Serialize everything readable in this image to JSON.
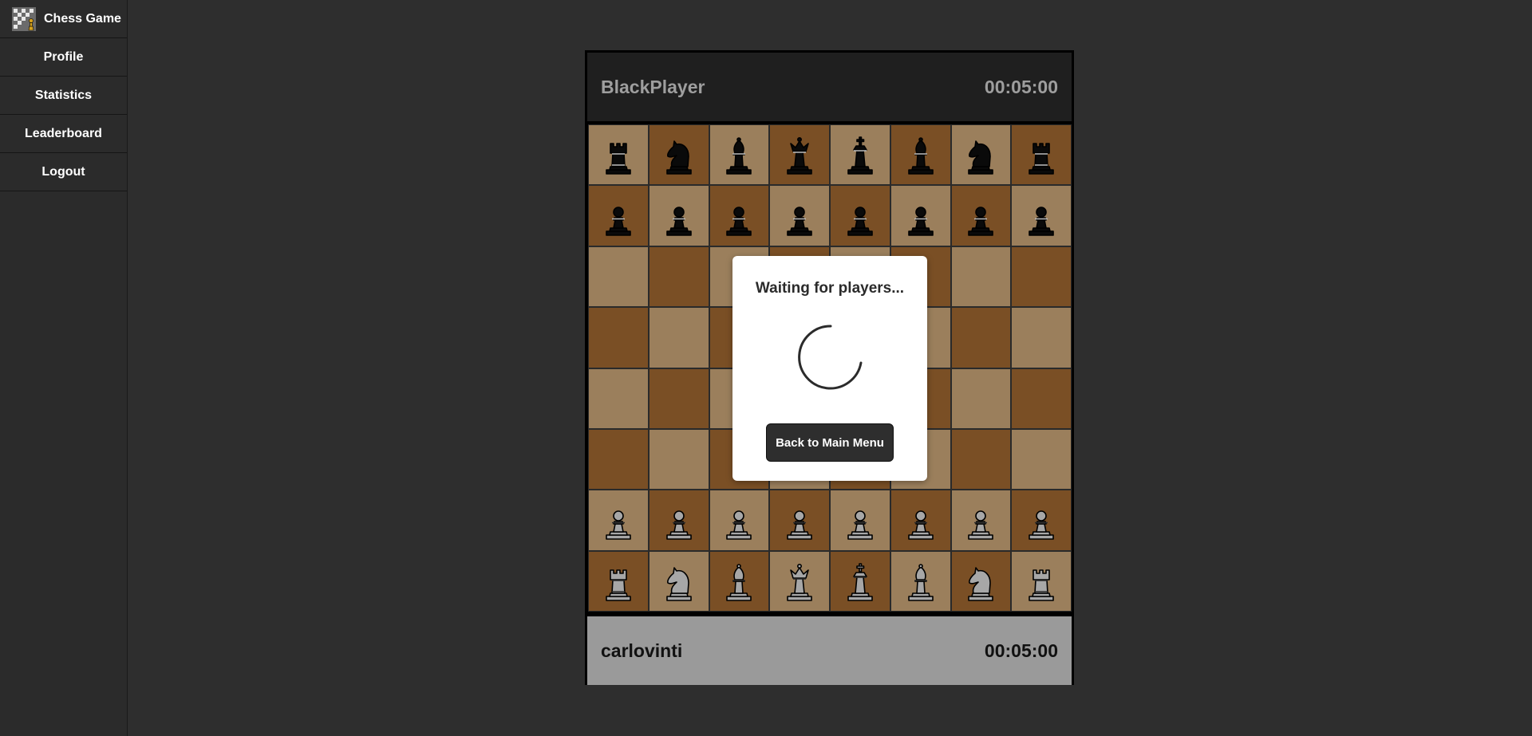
{
  "sidebar": {
    "brand": {
      "label": "Chess Game",
      "icon": "chess-board-logo-icon"
    },
    "items": [
      {
        "label": "Profile"
      },
      {
        "label": "Statistics"
      },
      {
        "label": "Leaderboard"
      },
      {
        "label": "Logout"
      }
    ]
  },
  "game": {
    "top_player": {
      "name": "BlackPlayer",
      "timer": "00:05:00"
    },
    "bottom_player": {
      "name": "carlovinti",
      "timer": "00:05:00"
    },
    "board": [
      [
        "br",
        "bn",
        "bb",
        "bq",
        "bk",
        "bb",
        "bn",
        "br"
      ],
      [
        "bp",
        "bp",
        "bp",
        "bp",
        "bp",
        "bp",
        "bp",
        "bp"
      ],
      [
        "",
        "",
        "",
        "",
        "",
        "",
        "",
        ""
      ],
      [
        "",
        "",
        "",
        "",
        "",
        "",
        "",
        ""
      ],
      [
        "",
        "",
        "",
        "",
        "",
        "",
        "",
        ""
      ],
      [
        "",
        "",
        "",
        "",
        "",
        "",
        "",
        ""
      ],
      [
        "wp",
        "wp",
        "wp",
        "wp",
        "wp",
        "wp",
        "wp",
        "wp"
      ],
      [
        "wr",
        "wn",
        "wb",
        "wq",
        "wk",
        "wb",
        "wn",
        "wr"
      ]
    ]
  },
  "modal": {
    "title": "Waiting for players...",
    "button_label": "Back to Main Menu"
  },
  "colors": {
    "light_square": "#9b7f5c",
    "dark_square": "#7a4f25",
    "black_piece": "#0a0a0a",
    "white_piece": "#a7a7a7"
  }
}
